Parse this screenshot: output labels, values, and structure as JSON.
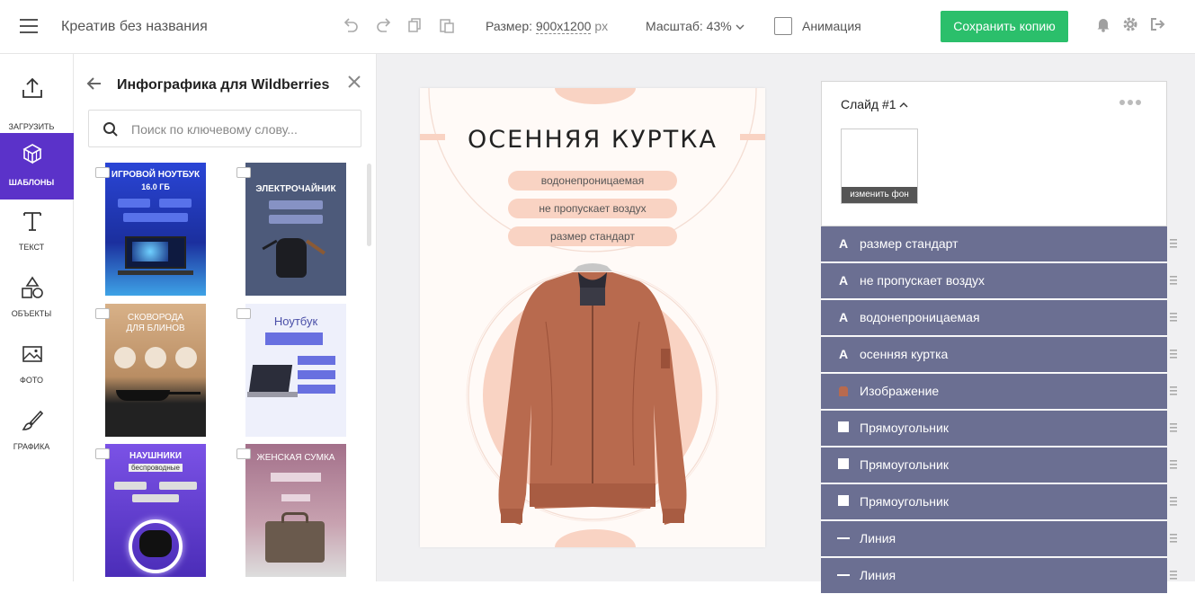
{
  "topbar": {
    "doc_title": "Креатив без названия",
    "size_label": "Размер:",
    "size_value": "900x1200",
    "size_unit": "px",
    "zoom_label": "Масштаб: 43%",
    "animation_label": "Анимация",
    "save_label": "Сохранить копию"
  },
  "nav": [
    {
      "label": "Загрузить",
      "icon": "upload-icon"
    },
    {
      "label": "Шаблоны",
      "icon": "templates-icon"
    },
    {
      "label": "Текст",
      "icon": "text-icon"
    },
    {
      "label": "Объекты",
      "icon": "shapes-icon"
    },
    {
      "label": "Фото",
      "icon": "photo-icon"
    },
    {
      "label": "Графика",
      "icon": "brush-icon"
    }
  ],
  "panel": {
    "title": "Инфографика для Wildberries",
    "search_placeholder": "Поиск по ключевому слову...",
    "templates": [
      {
        "title": "ИГРОВОЙ НОУТБУК",
        "subtitle": "16.0 ГБ",
        "bg": "#1e3fbf"
      },
      {
        "title": "ЭЛЕКТРОЧАЙНИК",
        "bg": "#4d5a7a"
      },
      {
        "title": "СКОВОРОДА ДЛЯ БЛИНОВ",
        "bg": "#c9a177"
      },
      {
        "title": "Ноутбук",
        "bg": "#eef0fb"
      },
      {
        "title": "НАУШНИКИ",
        "subtitle": "беспроводные",
        "bg": "#6d47d6"
      },
      {
        "title": "ЖЕНСКАЯ СУМКА",
        "bg": "#a3708a"
      }
    ]
  },
  "slide": {
    "title": "Осенняя куртка",
    "pills": [
      "водонепроницаемая",
      "не пропускает воздух",
      "размер стандарт"
    ]
  },
  "layers": {
    "slide_name": "Слайд #1",
    "change_bg": "изменить фон",
    "items": [
      {
        "icon": "text-layer-icon",
        "name": "размер стандарт"
      },
      {
        "icon": "text-layer-icon",
        "name": "не пропускает воздух"
      },
      {
        "icon": "text-layer-icon",
        "name": "водонепроницаемая"
      },
      {
        "icon": "text-layer-icon",
        "name": "осенняя куртка"
      },
      {
        "icon": "image-layer-icon",
        "name": "Изображение"
      },
      {
        "icon": "rectangle-layer-icon",
        "name": "Прямоугольник"
      },
      {
        "icon": "rectangle-layer-icon",
        "name": "Прямоугольник"
      },
      {
        "icon": "rectangle-layer-icon",
        "name": "Прямоугольник"
      },
      {
        "icon": "line-layer-icon",
        "name": "Линия"
      },
      {
        "icon": "line-layer-icon",
        "name": "Линия"
      }
    ]
  },
  "colors": {
    "accent": "#5b32c9",
    "save": "#2bbf6b",
    "layer_bg": "#6b6f92",
    "peach": "#f9d3c3",
    "jacket": "#b86a4e"
  }
}
